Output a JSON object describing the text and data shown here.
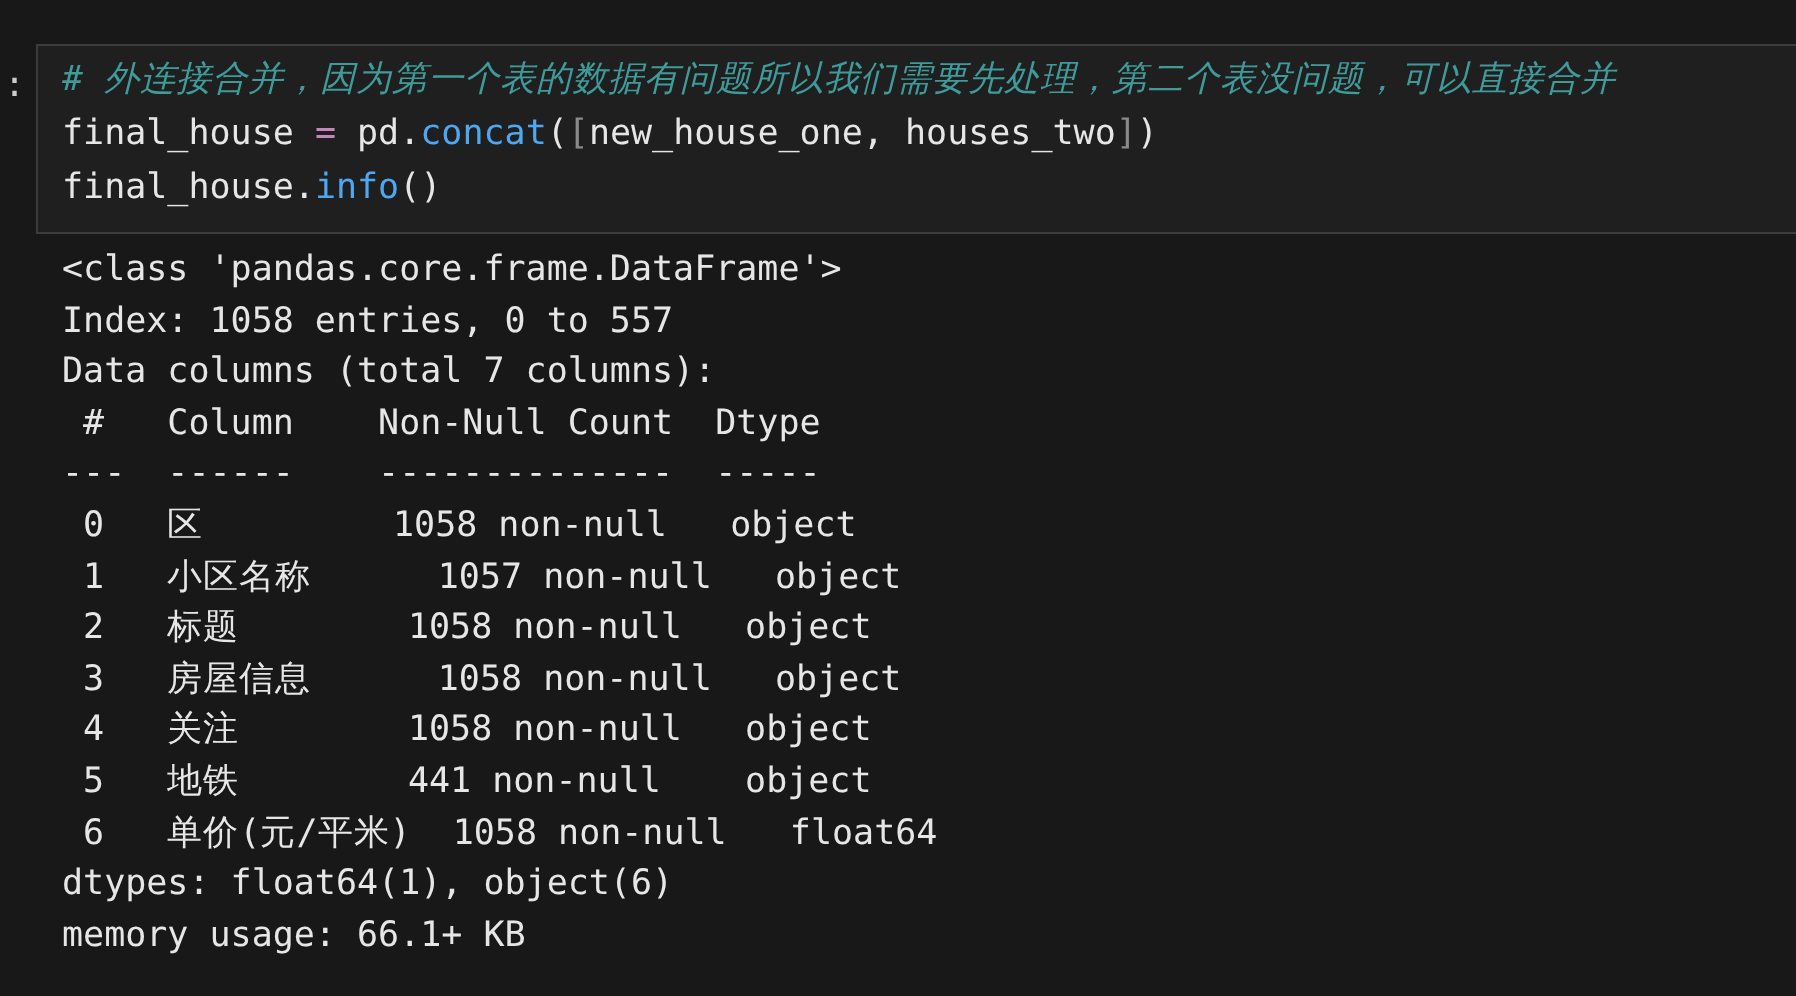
{
  "cell": {
    "prompt": ":",
    "code_lines": [
      [
        {
          "kind": "comment",
          "text": "# 外连接合并，因为第一个表的数据有问题所以我们需要先处理，第二个表没问题，可以直接合并"
        }
      ],
      [
        {
          "kind": "name",
          "text": "final_house "
        },
        {
          "kind": "operator",
          "text": "="
        },
        {
          "kind": "name",
          "text": " pd."
        },
        {
          "kind": "function",
          "text": "concat"
        },
        {
          "kind": "name",
          "text": "("
        },
        {
          "kind": "bracket",
          "text": "["
        },
        {
          "kind": "name",
          "text": "new_house_one, houses_two"
        },
        {
          "kind": "bracket",
          "text": "]"
        },
        {
          "kind": "name",
          "text": ")"
        }
      ],
      [
        {
          "kind": "name",
          "text": "final_house."
        },
        {
          "kind": "function",
          "text": "info"
        },
        {
          "kind": "name",
          "text": "()"
        }
      ]
    ]
  },
  "output_lines": [
    "<class 'pandas.core.frame.DataFrame'>",
    "Index: 1058 entries, 0 to 557",
    "Data columns (total 7 columns):",
    " #   Column    Non-Null Count  Dtype",
    "---  ------    --------------  -----",
    " 0   区         1058 non-null   object",
    " 1   小区名称      1057 non-null   object",
    " 2   标题        1058 non-null   object",
    " 3   房屋信息      1058 non-null   object",
    " 4   关注        1058 non-null   object",
    " 5   地铁        441 non-null    object",
    " 6   单价(元/平米)  1058 non-null   float64",
    "dtypes: float64(1), object(6)",
    "memory usage: 66.1+ KB"
  ]
}
